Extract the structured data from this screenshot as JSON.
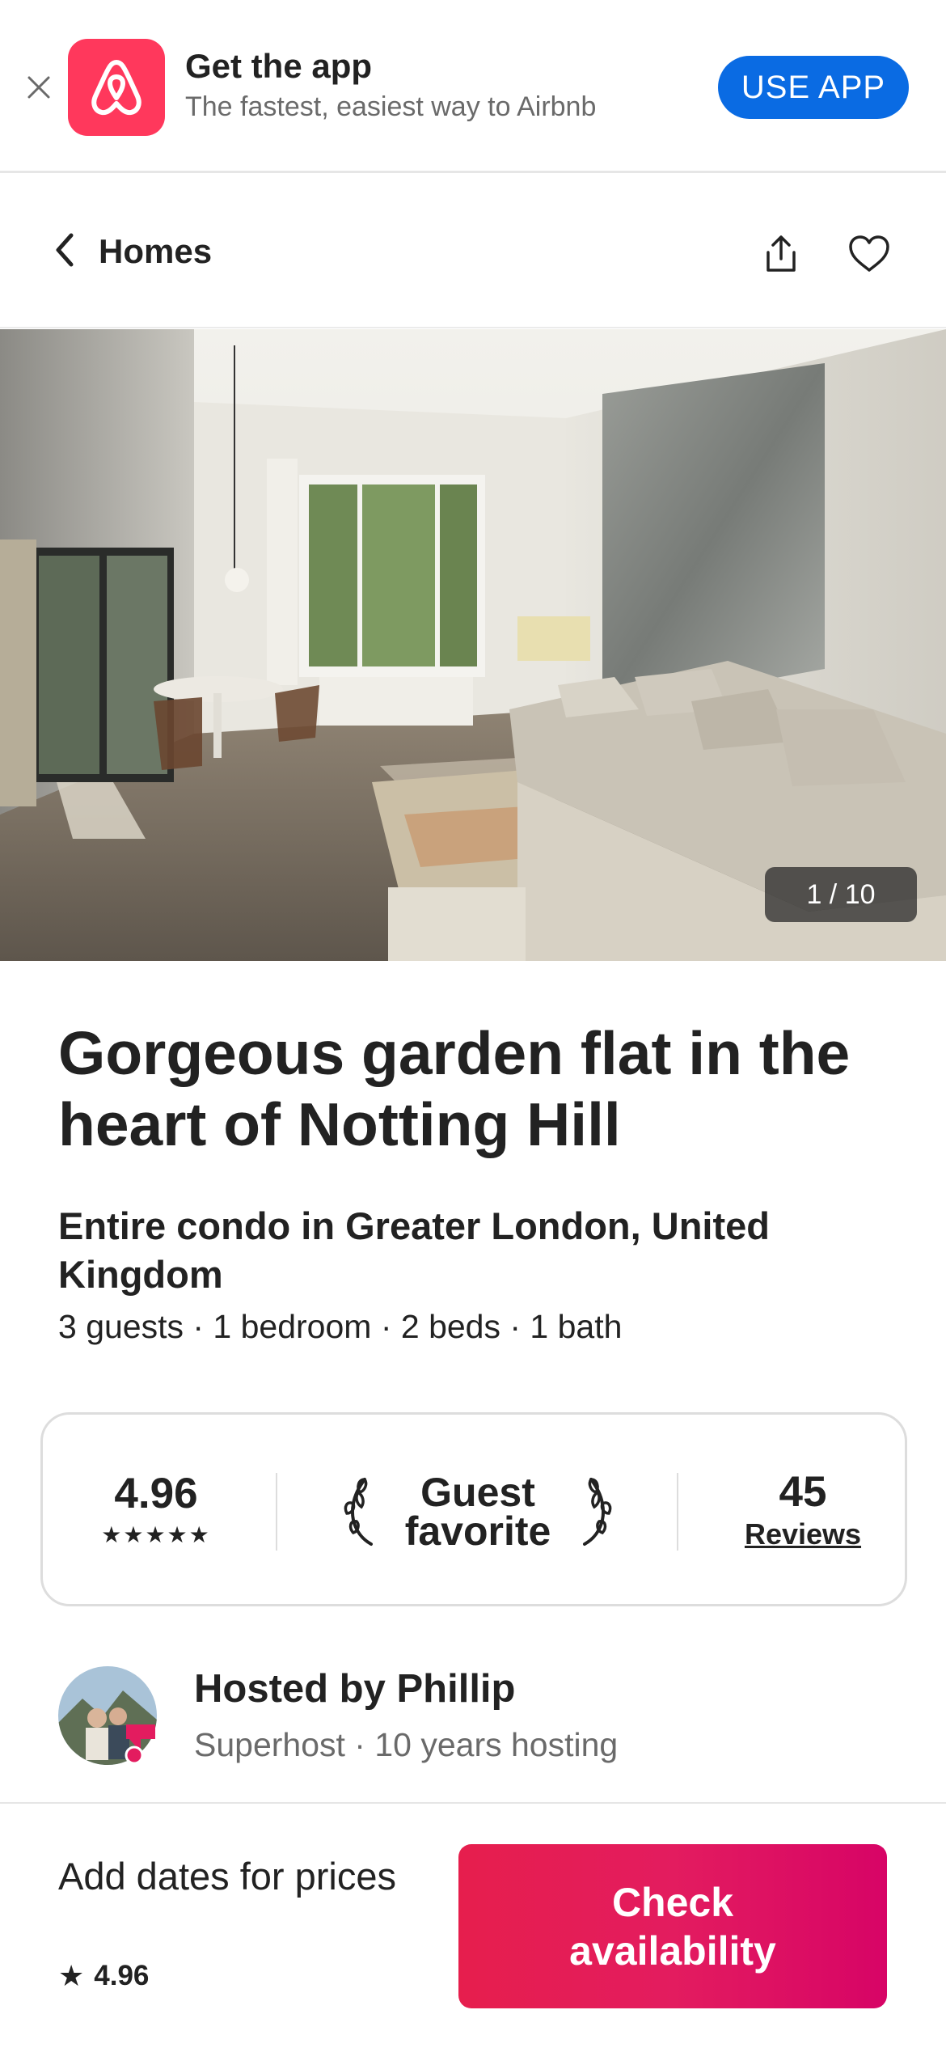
{
  "banner": {
    "close_icon": "close-icon",
    "logo_icon": "airbnb-logo-icon",
    "title": "Get the app",
    "subtitle": "The fastest, easiest way to Airbnb",
    "use_app_label": "USE APP"
  },
  "nav": {
    "back_label": "Homes",
    "back_icon": "chevron-left-icon",
    "share_icon": "share-icon",
    "save_icon": "heart-icon"
  },
  "gallery": {
    "counter": "1 / 10"
  },
  "listing": {
    "title": "Gorgeous garden flat in the heart of Notting Hill",
    "type": "Entire condo in Greater London, United Kingdom",
    "specs": "3 guests · 1 bedroom · 2 beds · 1 bath"
  },
  "rating_card": {
    "rating": "4.96",
    "stars": "★★★★★",
    "guest_favorite": "Guest favorite",
    "reviews_count": "45",
    "reviews_label": "Reviews"
  },
  "host": {
    "name": "Hosted by Phillip",
    "meta": "Superhost · 10 years hosting"
  },
  "footer": {
    "price_prompt": "Add dates for prices",
    "rating": "4.96",
    "check_label": "Check availability"
  },
  "colors": {
    "brand": "#ff385c",
    "use_app_blue": "#0a6be3",
    "cta_gradient_start": "#e61e4d",
    "cta_gradient_end": "#d70466",
    "text_primary": "#222222",
    "text_secondary": "#6a6a6a"
  }
}
